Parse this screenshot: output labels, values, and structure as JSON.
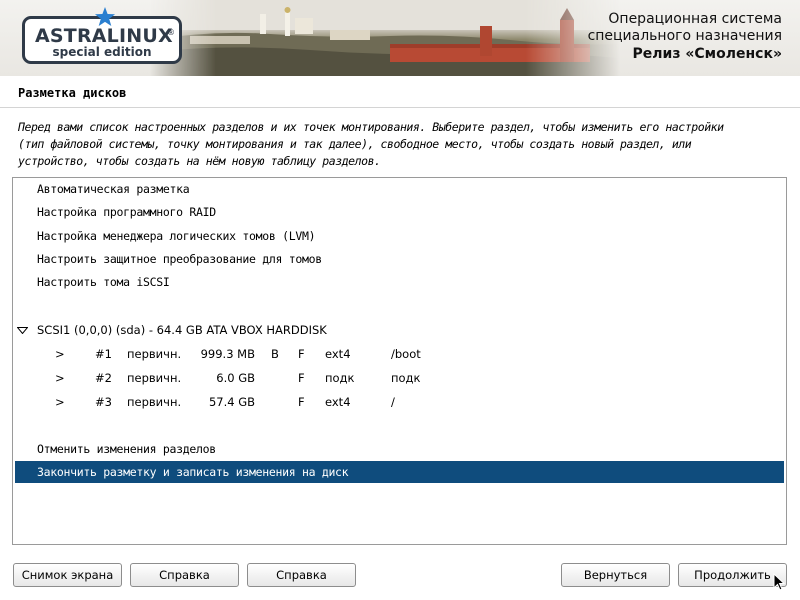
{
  "header": {
    "logo_text": "ASTRALINUX",
    "logo_reg": "®",
    "logo_subtitle": "special edition",
    "os_title_line1": "Операционная система",
    "os_title_line2": "специального назначения",
    "release": "Релиз «Смоленск»"
  },
  "page": {
    "title": "Разметка дисков",
    "description_lines": [
      "Перед вами список настроенных разделов и их точек монтирования. Выберите раздел, чтобы изменить его настройки",
      "(тип файловой системы, точку монтирования и так далее), свободное место, чтобы создать новый раздел, или",
      "устройство, чтобы создать на нём новую таблицу разделов."
    ]
  },
  "menu": {
    "items": [
      "Автоматическая разметка",
      "Настройка программного RAID",
      "Настройка менеджера логических томов (LVM)",
      "Настроить защитное преобразование для томов",
      "Настроить тома iSCSI"
    ],
    "disk_label": "SCSI1 (0,0,0) (sda) - 64.4 GB ATA VBOX HARDDISK",
    "partitions": [
      {
        "arrow": ">",
        "num": "#1",
        "type": "первичн.",
        "size": "999.3 MB",
        "boot": "B",
        "format": "F",
        "fs": "ext4",
        "mount": "/boot"
      },
      {
        "arrow": ">",
        "num": "#2",
        "type": "первичн.",
        "size": "6.0 GB",
        "boot": "",
        "format": "F",
        "fs": "подк",
        "mount": "подк"
      },
      {
        "arrow": ">",
        "num": "#3",
        "type": "первичн.",
        "size": "57.4 GB",
        "boot": "",
        "format": "F",
        "fs": "ext4",
        "mount": "/"
      }
    ],
    "undo_label": "Отменить изменения разделов",
    "finish_label": "Закончить разметку и записать изменения на диск"
  },
  "buttons": {
    "screenshot": "Снимок экрана",
    "help1": "Справка",
    "help2": "Справка",
    "back": "Вернуться",
    "continue": "Продолжить"
  },
  "colors": {
    "selection": "#0f4c7d",
    "logo": "#2f3a48",
    "star": "#2a7fd0"
  }
}
